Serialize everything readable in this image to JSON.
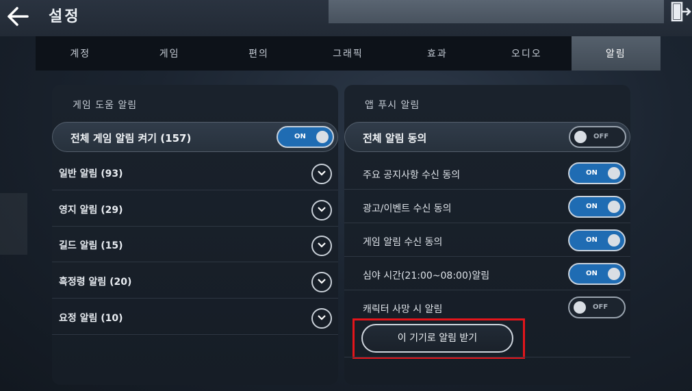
{
  "header": {
    "title": "설정",
    "back_icon": "arrow-left-icon",
    "exit_icon": "exit-door-icon"
  },
  "tabs": [
    {
      "label": "계정"
    },
    {
      "label": "게임"
    },
    {
      "label": "편의"
    },
    {
      "label": "그래픽"
    },
    {
      "label": "효과"
    },
    {
      "label": "오디오"
    },
    {
      "label": "알림",
      "active": true
    }
  ],
  "left_panel": {
    "title": "게임 도움 알림",
    "master": {
      "label": "전체 게임 알림 켜기 (157)",
      "toggle": "ON"
    },
    "items": [
      {
        "label": "일반 알림 (93)"
      },
      {
        "label": "영지 알림 (29)"
      },
      {
        "label": "길드 알림 (15)"
      },
      {
        "label": "흑정령 알림 (20)"
      },
      {
        "label": "요정 알림 (10)"
      }
    ]
  },
  "right_panel": {
    "title": "앱 푸시 알림",
    "master": {
      "label": "전체 알림 동의",
      "toggle": "OFF"
    },
    "items": [
      {
        "label": "주요 공지사항 수신 동의",
        "toggle": "ON"
      },
      {
        "label": "광고/이벤트 수신 동의",
        "toggle": "ON"
      },
      {
        "label": "게임 알림 수신 동의",
        "toggle": "ON"
      },
      {
        "label": "심야 시간(21:00~08:00)알림",
        "toggle": "ON"
      },
      {
        "label": "캐릭터 사망 시 알림",
        "toggle": "OFF"
      }
    ],
    "device_button": "이 기기로 알림 받기"
  },
  "colors": {
    "toggle_on": "#1f6cb3",
    "highlight": "#e4151b",
    "tab_active": "#4b5662"
  }
}
